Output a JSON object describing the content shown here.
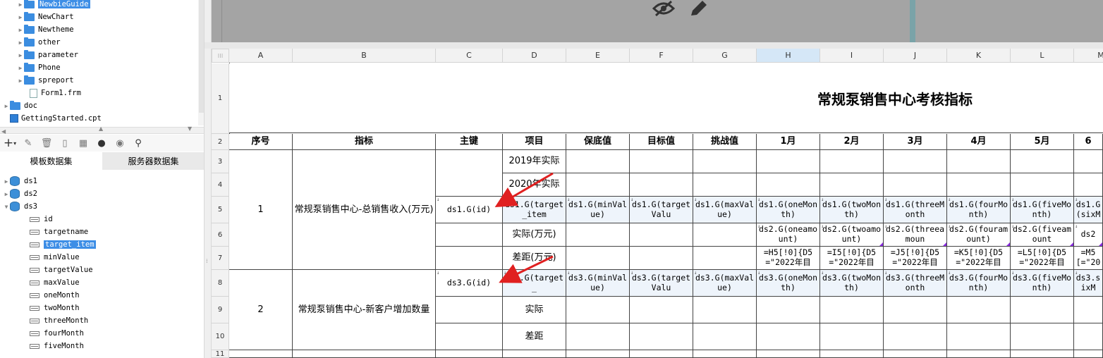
{
  "file_tree": [
    {
      "label": "NewbieGuide",
      "type": "folder",
      "selected": true
    },
    {
      "label": "NewChart",
      "type": "folder"
    },
    {
      "label": "Newtheme",
      "type": "folder"
    },
    {
      "label": "other",
      "type": "folder"
    },
    {
      "label": "parameter",
      "type": "folder"
    },
    {
      "label": "Phone",
      "type": "folder"
    },
    {
      "label": "spreport",
      "type": "folder"
    },
    {
      "label": "Form1.frm",
      "type": "file"
    },
    {
      "label": "doc",
      "type": "folder"
    },
    {
      "label": "GettingStarted.cpt",
      "type": "cpt"
    }
  ],
  "dataset_tabs": [
    "模板数据集",
    "服务器数据集"
  ],
  "datasets": [
    {
      "label": "ds1"
    },
    {
      "label": "ds2"
    },
    {
      "label": "ds3"
    }
  ],
  "ds3_fields": [
    "id",
    "targetname",
    "target_item",
    "minValue",
    "targetValue",
    "maxValue",
    "oneMonth",
    "twoMonth",
    "threeMonth",
    "fourMonth",
    "fiveMonth"
  ],
  "selected_field": "target_item",
  "columns": [
    "A",
    "B",
    "C",
    "D",
    "E",
    "F",
    "G",
    "H",
    "I",
    "J",
    "K",
    "L",
    "M"
  ],
  "rows": [
    "1",
    "2",
    "3",
    "4",
    "5",
    "6",
    "7",
    "8",
    "9",
    "10",
    "11"
  ],
  "sheet": {
    "title": "常规泵销售中心考核指标",
    "headers": [
      "序号",
      "指标",
      "主键",
      "项目",
      "保底值",
      "目标值",
      "挑战值",
      "1月",
      "2月",
      "3月",
      "4月",
      "5月",
      "6"
    ],
    "group1": {
      "seq": "1",
      "indicator": "常规泵销售中心-总销售收入(万元)",
      "key": "ds1.G(id)",
      "items": [
        "2019年实际",
        "2020年实际",
        "ds1.G(target_item",
        "实际(万元)",
        "差距(万元)"
      ],
      "row5": [
        "ds1.G(minValue)",
        "ds1.G(targetValu",
        "ds1.G(maxValue)",
        "ds1.G(oneMonth)",
        "ds1.G(twoMonth)",
        "ds1.G(threeMonth",
        "ds1.G(fourMonth)",
        "ds1.G(fiveMonth)",
        "ds1.G(sixM"
      ],
      "row6": [
        "ds2.G(oneamount)",
        "ds2.G(twoamount)",
        "ds2.G(threeamoun",
        "ds2.G(fouramount)",
        "ds2.G(fiveamount",
        "ds2"
      ],
      "row7": [
        "=H5[!0]{D5=\"2022年目",
        "=I5[!0]{D5=\"2022年目",
        "=J5[!0]{D5=\"2022年目",
        "=K5[!0]{D5=\"2022年目",
        "=L5[!0]{D5=\"2022年目",
        "=M5[=\"20"
      ]
    },
    "group2": {
      "seq": "2",
      "indicator": "常规泵销售中心-新客户增加数量",
      "key": "ds3.G(id)",
      "items": [
        "ds3.G(target_",
        "实际",
        "差距"
      ],
      "row8": [
        "ds3.G(minValue)",
        "ds3.G(targetValu",
        "ds3.G(maxValue)",
        "ds3.G(oneMonth)",
        "ds3.G(twoMonth)",
        "ds3.G(threeMonth",
        "ds3.G(fourMonth)",
        "ds3.G(fiveMonth)",
        "ds3.sixM"
      ]
    }
  },
  "colors": {
    "accent": "#3d8ee6",
    "expr_bg": "#eef4fb",
    "arrow": "#e02020",
    "preview_bg": "#a4a4a4"
  }
}
